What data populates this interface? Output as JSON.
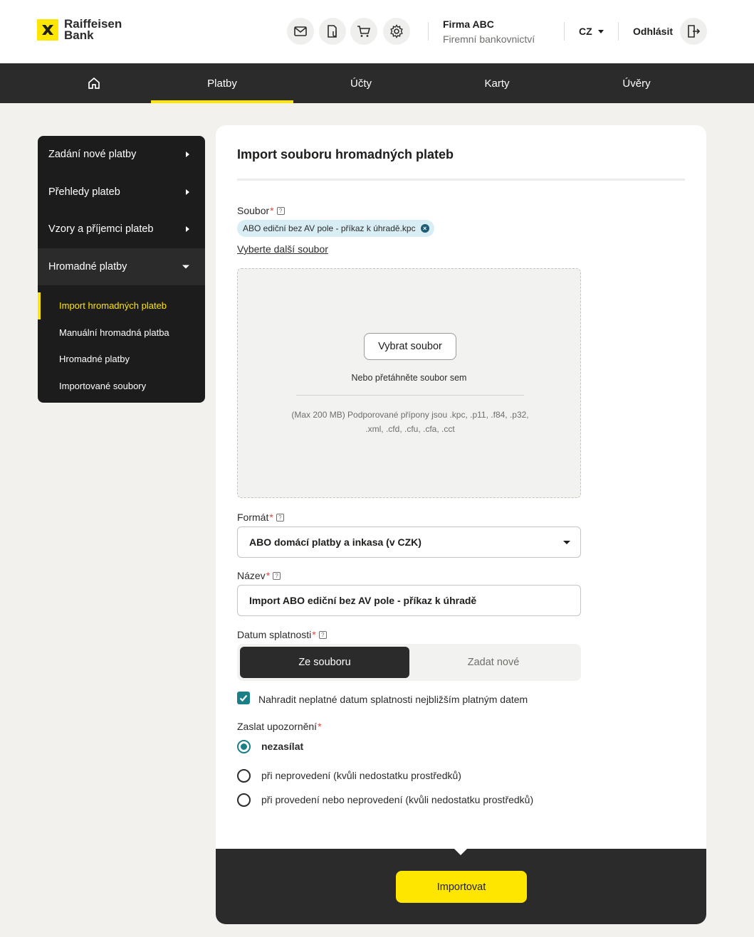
{
  "brand": {
    "name_line1": "Raiffeisen",
    "name_line2": "Bank",
    "accent": "#fee600",
    "teal": "#1a7f86"
  },
  "header": {
    "icons": [
      "mail-icon",
      "document-clip-icon",
      "cart-icon",
      "settings-icon"
    ],
    "company": "Firma ABC",
    "subtitle": "Firemní bankovnictví",
    "language": "CZ",
    "logout": "Odhlásit"
  },
  "nav": {
    "home_icon": "home-icon",
    "items": [
      "Platby",
      "Účty",
      "Karty",
      "Úvěry"
    ],
    "active": "Platby"
  },
  "sidebar": {
    "items": [
      "Zadání nové platby",
      "Přehledy plateb",
      "Vzory a příjemci plateb",
      "Hromadné platby"
    ],
    "submenu": [
      "Import hromadných plateb",
      "Manuální hromadná platba",
      "Hromadné platby",
      "Importované soubory"
    ],
    "active_submenu": "Import hromadných plateb"
  },
  "form": {
    "title": "Import souboru hromadných plateb",
    "file_label": "Soubor",
    "file_chip": "ABO ediční bez AV pole - příkaz k úhradě.kpc",
    "more_files_link": "Vyberte další soubor",
    "pick_button": "Vybrat soubor",
    "drop_hint": "Nebo přetáhněte soubor sem",
    "drop_note": "(Max 200 MB) Podporované přípony jsou .kpc, .p11, .f84, .p32, .xml, .cfd, .cfu, .cfa, .cct",
    "format_label": "Formát",
    "format_value": "ABO domácí platby a inkasa (v CZK)",
    "name_label": "Název",
    "name_value": "Import ABO ediční bez AV pole - příkaz k úhradě",
    "due_label": "Datum splatnosti",
    "due_options": [
      "Ze souboru",
      "Zadat nové"
    ],
    "due_selected": "Ze souboru",
    "replace_checkbox": "Nahradit neplatné datum splatnosti nejbližším platným datem",
    "replace_checked": true,
    "notify_label": "Zaslat upozornění",
    "notify_options": [
      "nezasílat",
      "při neprovedení (kvůli nedostatku prostředků)",
      "při provedení nebo neprovedení (kvůli nedostatku prostředků)"
    ],
    "notify_selected": "nezasílat",
    "required_mark": "*",
    "help_mark": "?",
    "submit": "Importovat"
  }
}
